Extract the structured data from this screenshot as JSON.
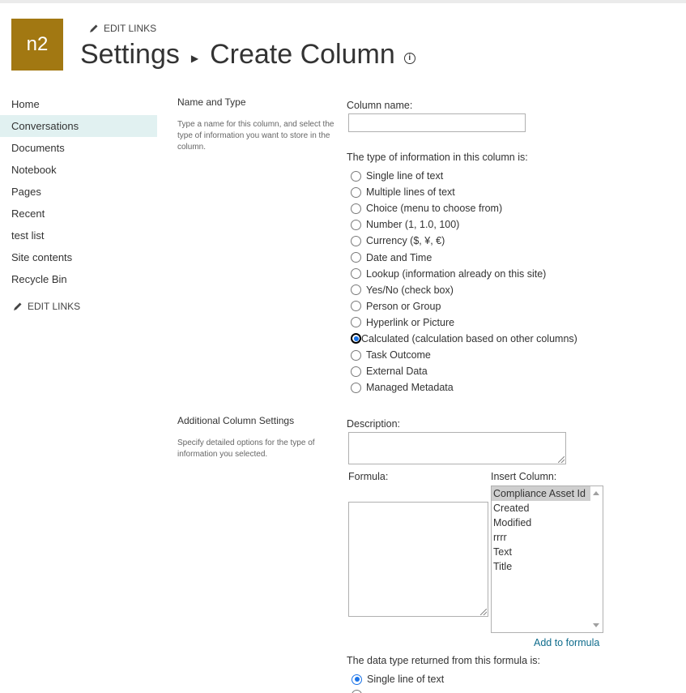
{
  "site": {
    "logo_text": "n2"
  },
  "header": {
    "edit_links": "EDIT LINKS",
    "crumb_parent": "Settings",
    "crumb_current": "Create Column",
    "info_glyph": "i"
  },
  "nav": {
    "items": [
      {
        "label": "Home"
      },
      {
        "label": "Conversations",
        "selected": true
      },
      {
        "label": "Documents"
      },
      {
        "label": "Notebook"
      },
      {
        "label": "Pages"
      },
      {
        "label": "Recent"
      },
      {
        "label": "test list"
      },
      {
        "label": "Site contents"
      },
      {
        "label": "Recycle Bin"
      }
    ],
    "edit_links": "EDIT LINKS"
  },
  "name_type": {
    "title": "Name and Type",
    "desc": "Type a name for this column, and select the type of information you want to store in the column.",
    "column_name_label": "Column name:",
    "column_name_value": "",
    "type_label": "The type of information in this column is:",
    "types": [
      "Single line of text",
      "Multiple lines of text",
      "Choice (menu to choose from)",
      "Number (1, 1.0, 100)",
      "Currency ($, ¥, €)",
      "Date and Time",
      "Lookup (information already on this site)",
      "Yes/No (check box)",
      "Person or Group",
      "Hyperlink or Picture",
      "Calculated (calculation based on other columns)",
      "Task Outcome",
      "External Data",
      "Managed Metadata"
    ],
    "selected_type": "Calculated (calculation based on other columns)"
  },
  "additional": {
    "title": "Additional Column Settings",
    "desc": "Specify detailed options for the type of information you selected.",
    "description_label": "Description:",
    "description_value": "",
    "formula_label": "Formula:",
    "formula_value": "",
    "insert_column_label": "Insert Column:",
    "columns": [
      "Compliance Asset Id",
      "Created",
      "Modified",
      "rrrr",
      "Text",
      "Title"
    ],
    "selected_column": "Compliance Asset Id",
    "add_to_formula": "Add to formula",
    "return_type_label": "The data type returned from this formula is:",
    "return_types": [
      "Single line of text"
    ],
    "selected_return_type": "Single line of text"
  },
  "colors": {
    "brand": "#a27812",
    "nav_selected": "#e1f1f1",
    "link": "#0f6c8c",
    "radio_accent": "#1a73e8"
  }
}
